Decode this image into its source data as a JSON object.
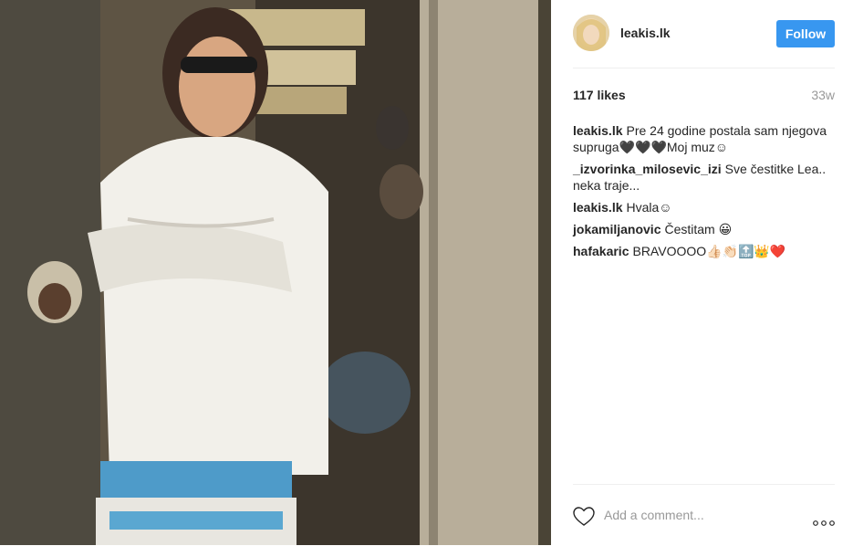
{
  "post": {
    "username": "leakis.lk",
    "follow_label": "Follow",
    "likes_text": "117 likes",
    "time_ago": "33w",
    "comments": [
      {
        "author": "leakis.lk",
        "text": "Pre 24 godine postala sam njegova supruga🖤🖤🖤Moj muz☺"
      },
      {
        "author": "_izvorinka_milosevic_izi",
        "text": "Sve čestitke Lea.. neka traje..."
      },
      {
        "author": "leakis.lk",
        "text": "Hvala☺"
      },
      {
        "author": "jokamiljanovic",
        "text": "Čestitam 😀"
      },
      {
        "author": "hafakaric",
        "text": "BRAVOOOO👍🏻👏🏻🔝👑❤️"
      }
    ],
    "add_comment_placeholder": "Add a comment...",
    "icons": {
      "heart": "heart-outline-icon",
      "more": "more-options-icon"
    }
  }
}
